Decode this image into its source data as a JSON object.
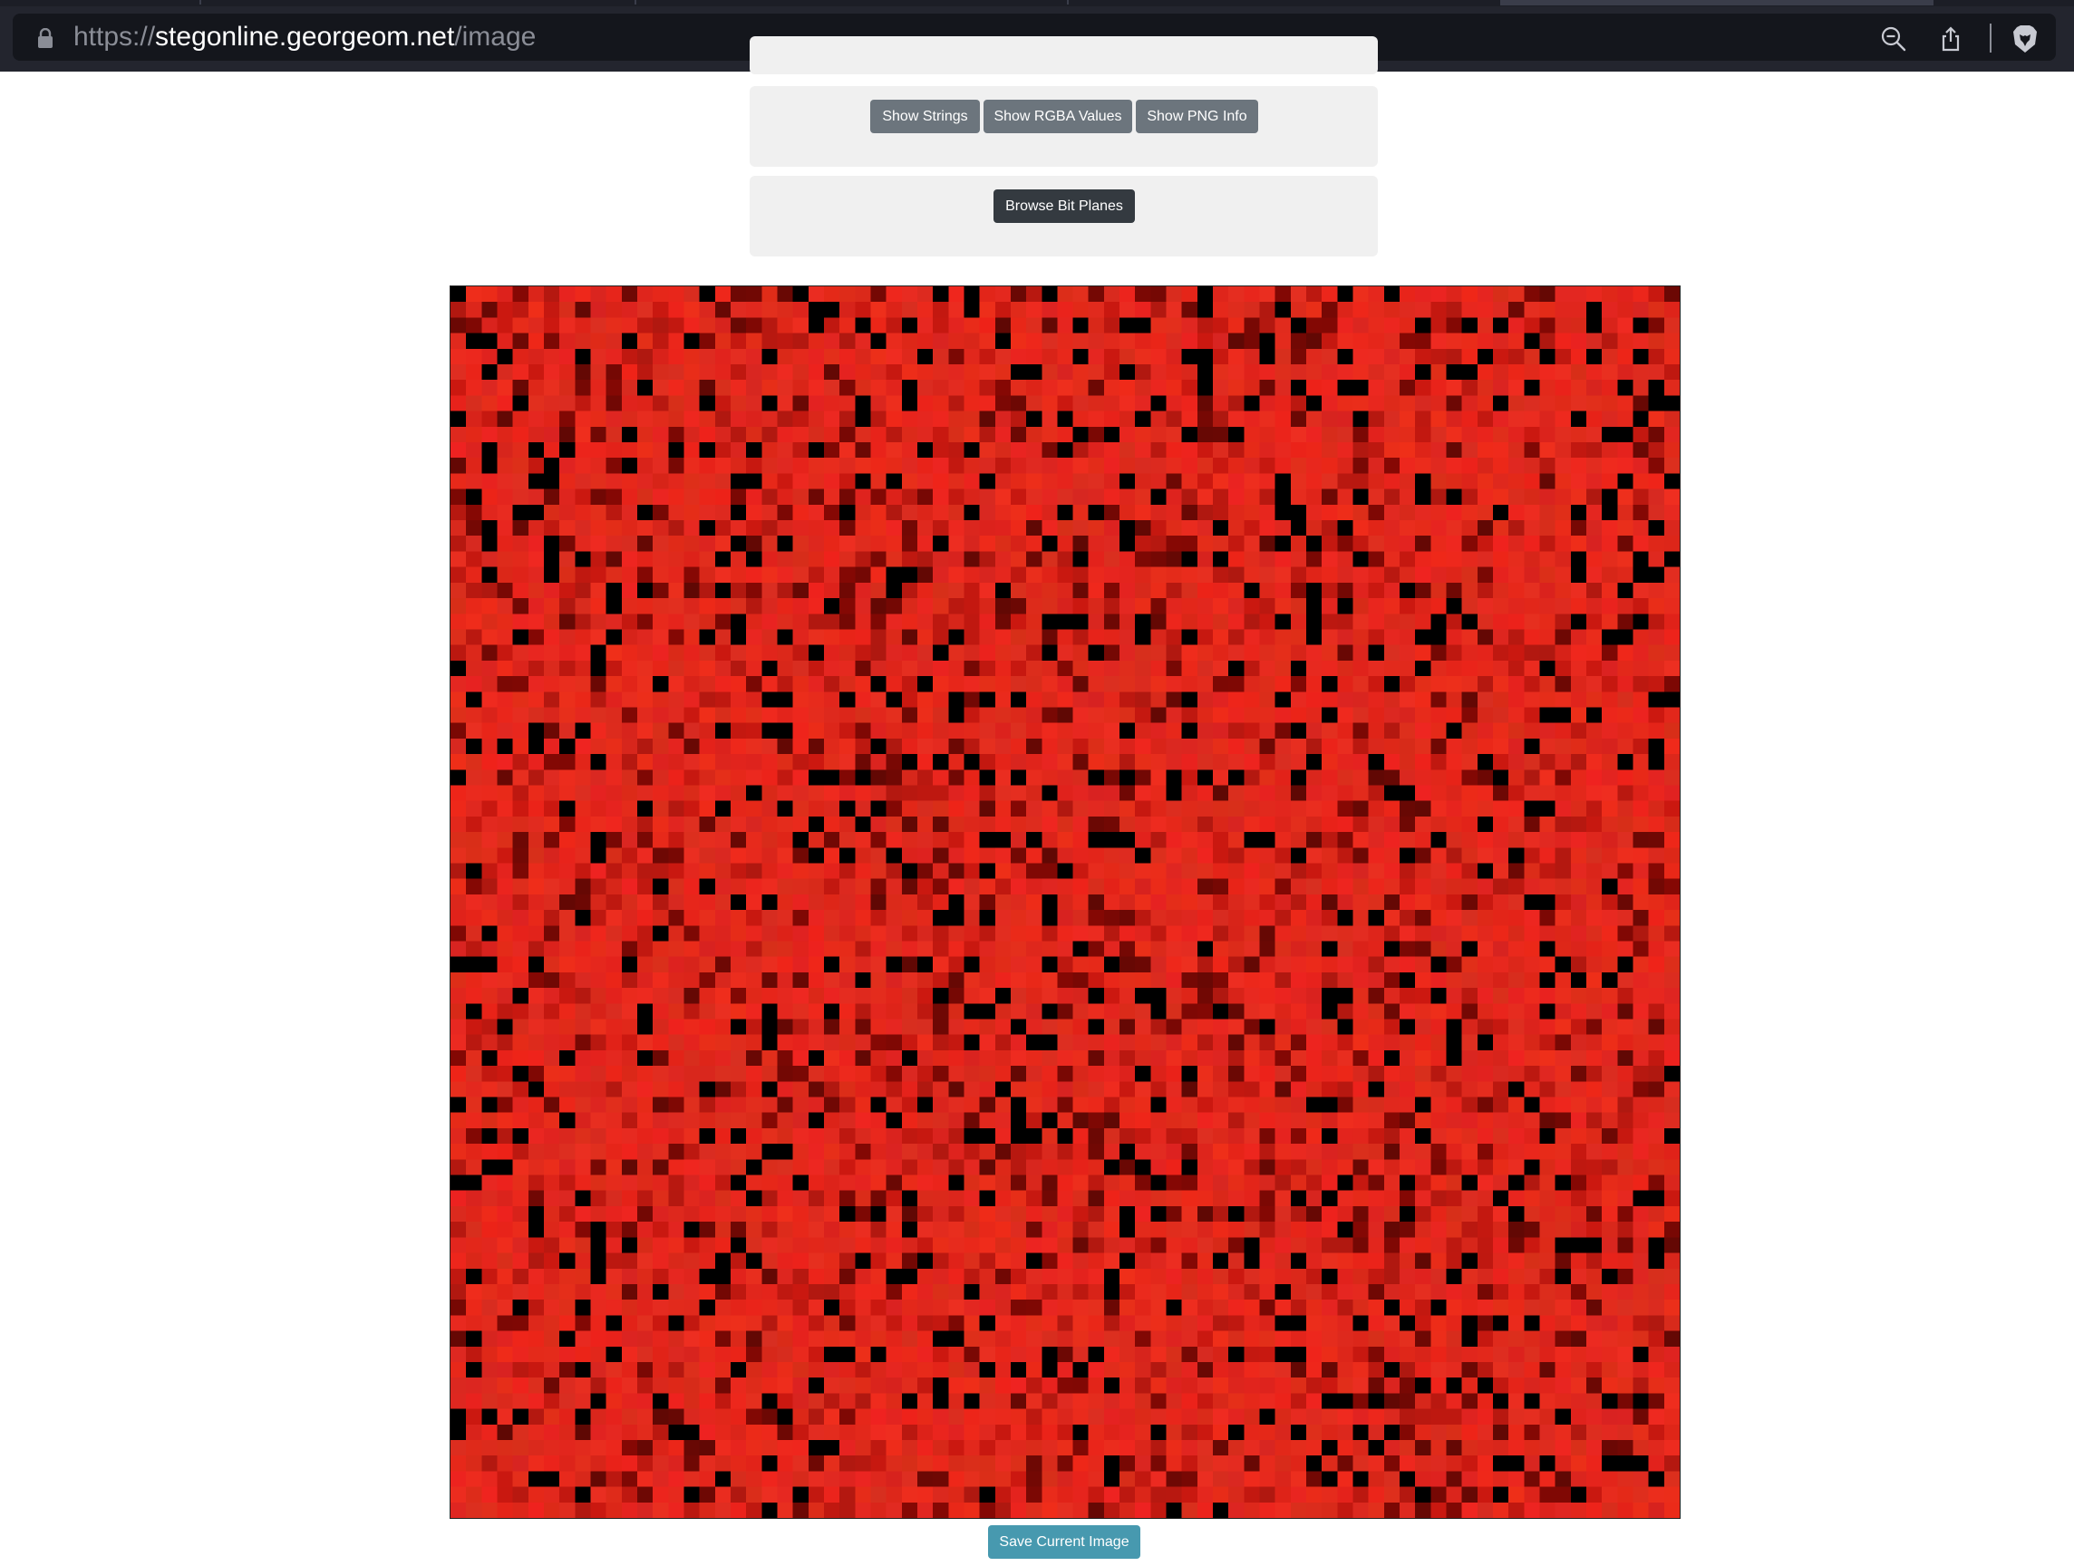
{
  "browser": {
    "url_scheme": "https://",
    "url_host": "stegonline.georgeom.net",
    "url_path": "/image",
    "icons": [
      "lock-icon",
      "zoom-out-icon",
      "share-icon",
      "brave-lion-icon"
    ]
  },
  "toolbar": {
    "show_strings": "Show Strings",
    "show_rgba_values": "Show RGBA Values",
    "show_png_info": "Show PNG Info",
    "browse_bit_planes": "Browse Bit Planes"
  },
  "image_view": {
    "description_colors": {
      "base": "#e6281e",
      "dark": "#000000"
    }
  },
  "footer": {
    "save_current_image": "Save Current Image"
  },
  "colors": {
    "chrome_bg": "#23252e",
    "urlbar_bg": "#14161c",
    "button_grey": "#6c757d",
    "button_dark": "#343a40",
    "button_teal": "#4799af",
    "panel_bg": "#f0f0f0"
  }
}
